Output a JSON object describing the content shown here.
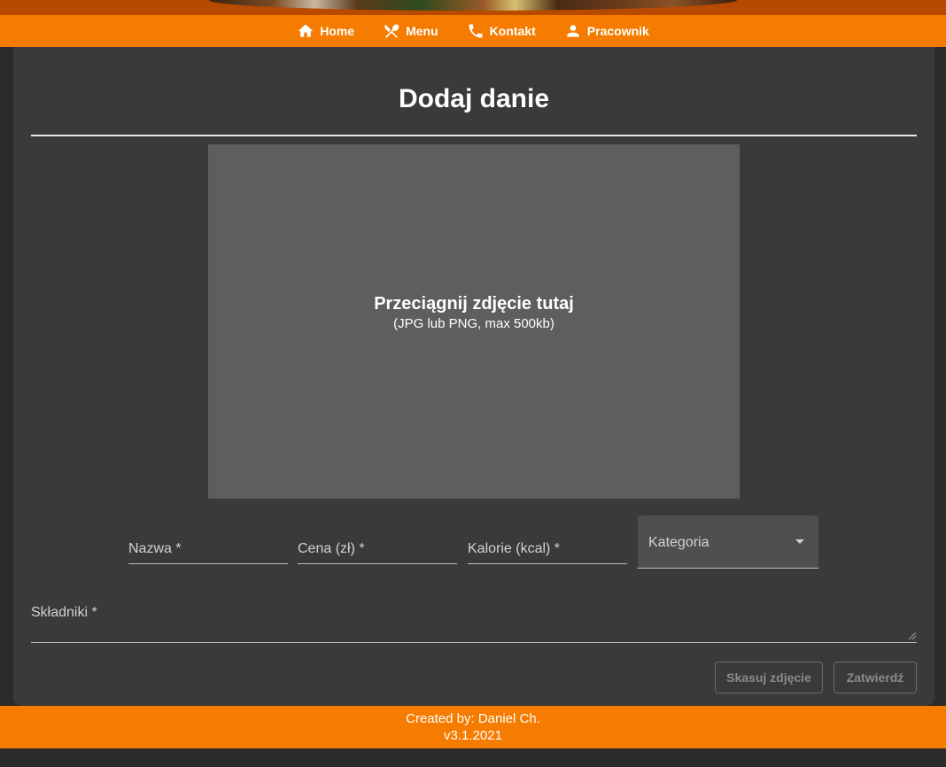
{
  "nav": {
    "items": [
      {
        "label": "Home",
        "icon": "home-icon"
      },
      {
        "label": "Menu",
        "icon": "fork-knife-icon"
      },
      {
        "label": "Kontakt",
        "icon": "phone-icon"
      },
      {
        "label": "Pracownik",
        "icon": "person-icon"
      }
    ]
  },
  "form": {
    "title": "Dodaj danie",
    "dropzone": {
      "title": "Przeciągnij zdjęcie tutaj",
      "hint": "(JPG lub PNG, max 500kb)"
    },
    "fields": {
      "name": "Nazwa *",
      "price": "Cena (zł) *",
      "calories": "Kalorie (kcal) *",
      "category": "Kategoria",
      "ingredients": "Składniki *"
    },
    "buttons": {
      "delete_photo": "Skasuj zdjęcie",
      "submit": "Zatwierdź"
    }
  },
  "footer": {
    "author": "Created by: Daniel Ch.",
    "version": "v3.1.2021"
  },
  "colors": {
    "accent": "#f57c00",
    "card": "#3a3a3a",
    "background": "#2b2b2b",
    "dropzone": "#5e5e5e"
  }
}
